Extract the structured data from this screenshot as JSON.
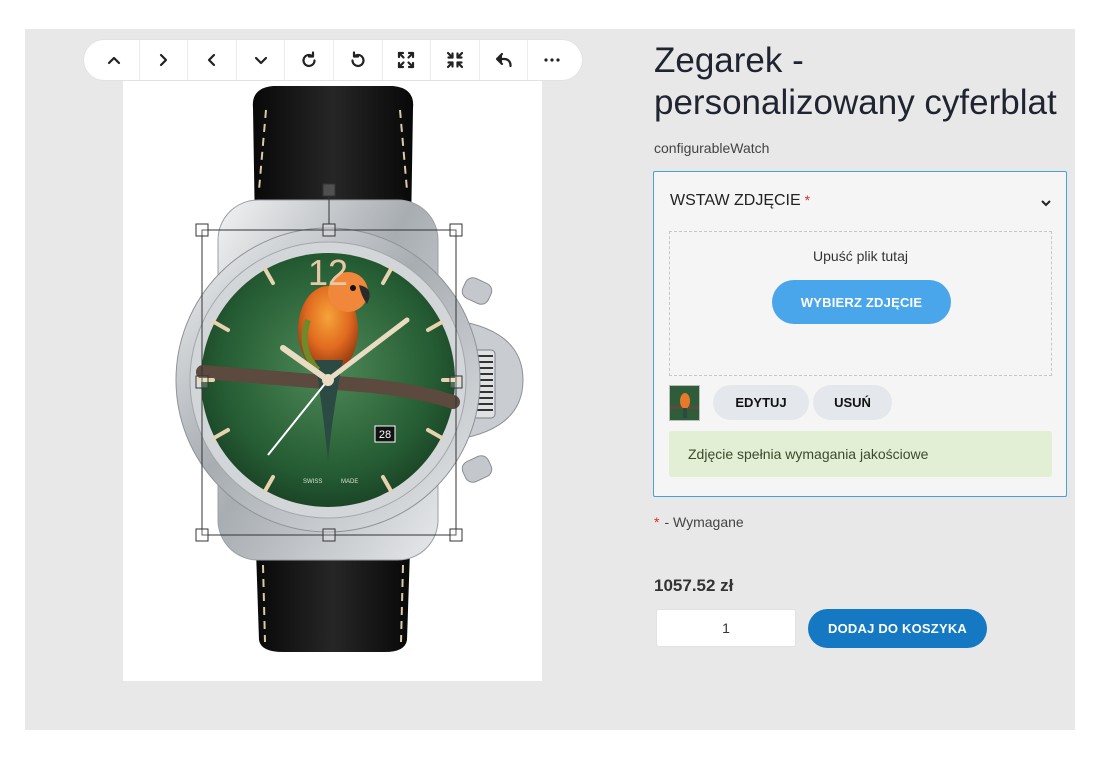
{
  "toolbar": {
    "buttons": [
      "move-up",
      "move-right",
      "move-left",
      "move-down",
      "rotate-clockwise",
      "rotate-counterclockwise",
      "expand",
      "shrink",
      "undo",
      "more"
    ]
  },
  "preview": {
    "watch_numeral": "12",
    "date_window": "28",
    "dial_text_left": "SWISS",
    "dial_text_right": "MADE",
    "colors": {
      "strap": "#151515",
      "case": "#b9bdc1",
      "dial": "#2f6b3c"
    }
  },
  "product": {
    "title": "Zegarek - personalizowany cyferblat",
    "sku": "configurableWatch",
    "price": "1057.52 zł",
    "qty": "1",
    "add_to_cart": "DODAJ DO KOSZYKA"
  },
  "option": {
    "label": "WSTAW ZDJĘCIE",
    "required_mark": "*",
    "drop_text": "Upuść plik tutaj",
    "choose_button": "WYBIERZ ZDJĘCIE",
    "edit_button": "EDYTUJ",
    "remove_button": "USUŃ",
    "quality_message": "Zdjęcie spełnia wymagania jakościowe"
  },
  "required_note": {
    "mark": "*",
    "text": "- Wymagane"
  },
  "colors": {
    "accent": "#4aa6ea",
    "primary_button": "#1479c2",
    "required": "#e02b27",
    "success_bg": "#e3efd5",
    "border_active": "#4a9fd8"
  }
}
